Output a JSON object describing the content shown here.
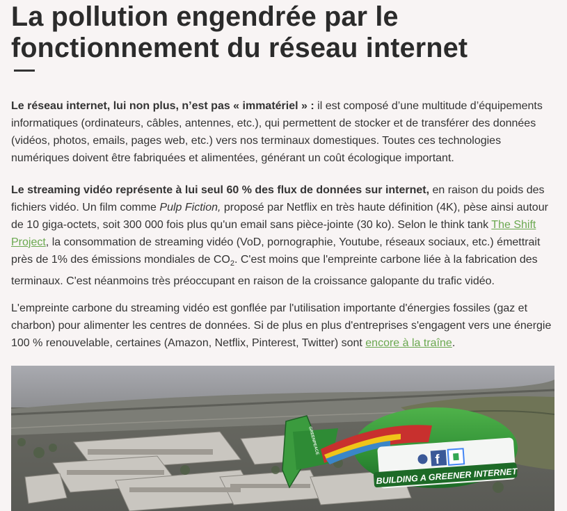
{
  "article": {
    "title": "La pollution engendrée par le fonctionnement du réseau internet",
    "p1": {
      "bold": "Le réseau internet, lui non plus, n’est pas « immatériel » :",
      "text": " il est composé d’une multitude d’équipements informatiques (ordinateurs, câbles, antennes, etc.), qui permettent de stocker et de transférer des données (vidéos, photos, emails, pages web, etc.) vers nos terminaux domestiques. Toutes ces technologies numériques doivent être fabriquées et alimentées, générant un coût écologique important."
    },
    "p2": {
      "bold": "Le streaming vidéo représente à lui seul 60 % des flux de données sur internet,",
      "text_a": " en raison du poids des fichiers vidéo. Un film comme ",
      "italic": "Pulp Fiction,",
      "text_b": " proposé par Netflix en très haute définition (4K), pèse ainsi autour de 10 giga-octets, soit 300 000 fois plus qu'un email sans pièce-jointe (30 ko). Selon le think tank ",
      "link": "The Shift Project",
      "text_c": ", la consommation de streaming vidéo (VoD, pornographie, Youtube, réseaux sociaux, etc.) émettrait près de 1% des émissions mondiales de CO",
      "sub": "2",
      "text_d": ". C'est moins que l'empreinte carbone liée à la fabrication des terminaux. C'est néanmoins très préoccupant en raison de la croissance galopante du trafic vidéo."
    },
    "p3": {
      "text_a": "L'empreinte carbone du streaming vidéo est gonflée par l'utilisation importante d'énergies fossiles (gaz et charbon) pour alimenter les centres de données. Si de plus en plus d'entreprises s'engagent vers une énergie 100 % renouvelable, certaines (Amazon, Netflix, Pinterest, Twitter) sont ",
      "link": "encore à la traîne",
      "text_b": "."
    }
  },
  "image": {
    "blimp_text": "BUILDING A GREENER INTERNET",
    "blimp_logo": "GREENPEACE",
    "facebook_letter": "f"
  },
  "colors": {
    "background": "#f8f4f4",
    "text": "#333333",
    "link": "#6aa84f",
    "blimp_green": "#2e8b3a"
  }
}
